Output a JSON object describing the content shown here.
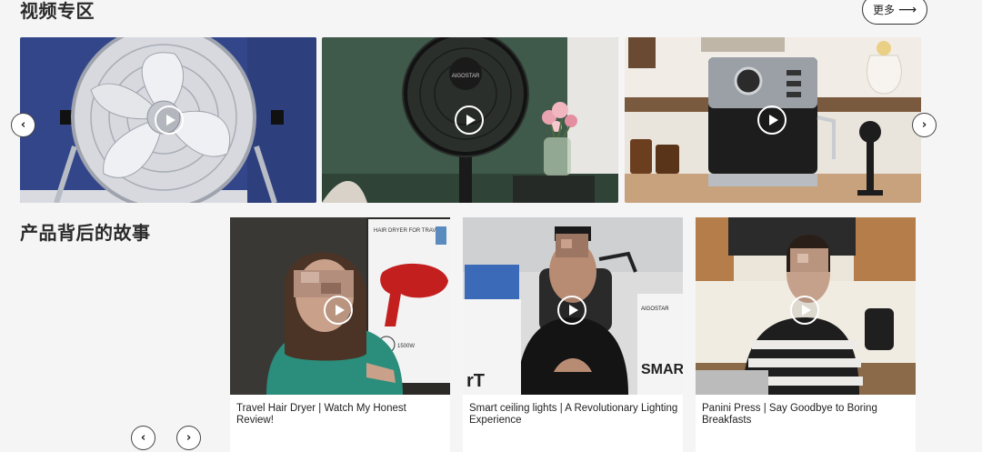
{
  "video_section": {
    "title": "视频专区",
    "more_label": "更多",
    "more_arrow": "⟶",
    "prev_icon": "‹",
    "next_icon": "›",
    "cards": [
      {
        "name": "video-card-floor-fan"
      },
      {
        "name": "video-card-pedestal-fan",
        "brand": "AIGOSTAR"
      },
      {
        "name": "video-card-espresso-machine"
      }
    ]
  },
  "story_section": {
    "title": "产品背后的故事",
    "prev_icon": "‹",
    "next_icon": "›",
    "cards": [
      {
        "caption": "Travel Hair Dryer | Watch My Honest Review!",
        "box_text": "HAIR DRYER FOR TRAVEL",
        "box_spec": "1500W"
      },
      {
        "caption": "Smart ceiling lights | A Revolutionary Lighting Experience",
        "box_brand": "AIGOSTAR",
        "box_big": "SMAR"
      },
      {
        "caption": "Panini Press | Say Goodbye to Boring Breakfasts"
      }
    ]
  },
  "colors": {
    "background": "#f5f5f5",
    "fan_backdrop": "#34478a",
    "green_wall": "#3f5a4a",
    "kitchen_white": "#e9e4dc"
  }
}
